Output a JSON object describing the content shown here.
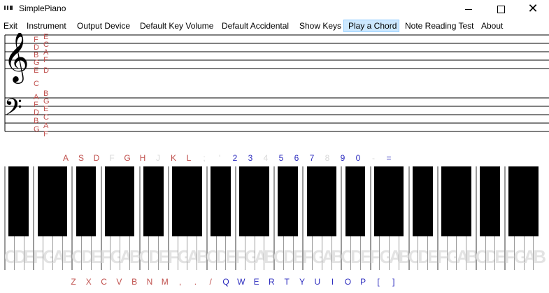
{
  "window": {
    "title": "SimplePiano",
    "minimize_glyph": "",
    "maximize_glyph": "",
    "close_glyph": "✕"
  },
  "menu": {
    "items": [
      {
        "label": "Exit",
        "active": false
      },
      {
        "label": "Instrument",
        "active": false
      },
      {
        "label": "Output Device",
        "active": false
      },
      {
        "label": "Default Key Volume",
        "active": false
      },
      {
        "label": "Default Accidental",
        "active": false
      },
      {
        "label": "Show Keys",
        "active": false
      },
      {
        "label": "Play a Chord",
        "active": true
      },
      {
        "label": "Note Reading Test",
        "active": false
      },
      {
        "label": "About",
        "active": false
      }
    ]
  },
  "staff": {
    "treble_clef": "𝄞",
    "bass_clef": "𝄢",
    "treble_left_column": [
      "F",
      "D",
      "B",
      "G",
      "E",
      "C"
    ],
    "treble_right_column": [
      "E",
      "C",
      "A",
      "F",
      "D"
    ],
    "bass_left_column": [
      "A",
      "F",
      "D",
      "B",
      "G"
    ],
    "bass_right_column": [
      "B",
      "G",
      "E",
      "C",
      "A",
      "F"
    ]
  },
  "keyboard_labels": {
    "upper": [
      {
        "text": "A",
        "color": "red"
      },
      {
        "text": "S",
        "color": "red"
      },
      {
        "text": "D",
        "color": "red"
      },
      {
        "text": "F",
        "color": "faint"
      },
      {
        "text": "G",
        "color": "red"
      },
      {
        "text": "H",
        "color": "red"
      },
      {
        "text": "J",
        "color": "faint"
      },
      {
        "text": "K",
        "color": "red"
      },
      {
        "text": "L",
        "color": "red"
      },
      {
        "text": ";",
        "color": "faint"
      },
      {
        "text": "'",
        "color": "faint"
      },
      {
        "text": "2",
        "color": "blue"
      },
      {
        "text": "3",
        "color": "blue"
      },
      {
        "text": "4",
        "color": "faint"
      },
      {
        "text": "5",
        "color": "blue"
      },
      {
        "text": "6",
        "color": "blue"
      },
      {
        "text": "7",
        "color": "blue"
      },
      {
        "text": "8",
        "color": "faint"
      },
      {
        "text": "9",
        "color": "blue"
      },
      {
        "text": "0",
        "color": "blue"
      },
      {
        "text": "-",
        "color": "faint"
      },
      {
        "text": "=",
        "color": "blue"
      }
    ],
    "lower": [
      {
        "text": "Z",
        "color": "red"
      },
      {
        "text": "X",
        "color": "red"
      },
      {
        "text": "C",
        "color": "red"
      },
      {
        "text": "V",
        "color": "red"
      },
      {
        "text": "B",
        "color": "red"
      },
      {
        "text": "N",
        "color": "red"
      },
      {
        "text": "M",
        "color": "red"
      },
      {
        "text": ",",
        "color": "red"
      },
      {
        "text": ".",
        "color": "red"
      },
      {
        "text": "/",
        "color": "red"
      },
      {
        "text": "Q",
        "color": "blue"
      },
      {
        "text": "W",
        "color": "blue"
      },
      {
        "text": "E",
        "color": "blue"
      },
      {
        "text": "R",
        "color": "blue"
      },
      {
        "text": "T",
        "color": "blue"
      },
      {
        "text": "Y",
        "color": "blue"
      },
      {
        "text": "U",
        "color": "blue"
      },
      {
        "text": "I",
        "color": "blue"
      },
      {
        "text": "O",
        "color": "blue"
      },
      {
        "text": "P",
        "color": "blue"
      },
      {
        "text": "[",
        "color": "blue"
      },
      {
        "text": "]",
        "color": "blue"
      }
    ]
  },
  "piano": {
    "white_key_letters": [
      "C",
      "D",
      "E",
      "F",
      "G",
      "A",
      "B",
      "C",
      "D",
      "E",
      "F",
      "G",
      "A",
      "B",
      "C",
      "D",
      "E",
      "F",
      "G",
      "A",
      "B",
      "C",
      "D",
      "E",
      "F",
      "G",
      "A",
      "B",
      "C",
      "D",
      "E",
      "F",
      "G",
      "A",
      "B",
      "C",
      "D",
      "E",
      "F",
      "G",
      "A",
      "B",
      "C",
      "D",
      "E",
      "F",
      "G",
      "A",
      "B",
      "C",
      "D",
      "E",
      "F",
      "G",
      "A",
      "B"
    ]
  },
  "colors": {
    "note_red": "#c0504d",
    "key_blue": "#2d2dbf",
    "menu_active_bg": "#cce8ff",
    "white_key_letter": "#e3e3e3"
  }
}
